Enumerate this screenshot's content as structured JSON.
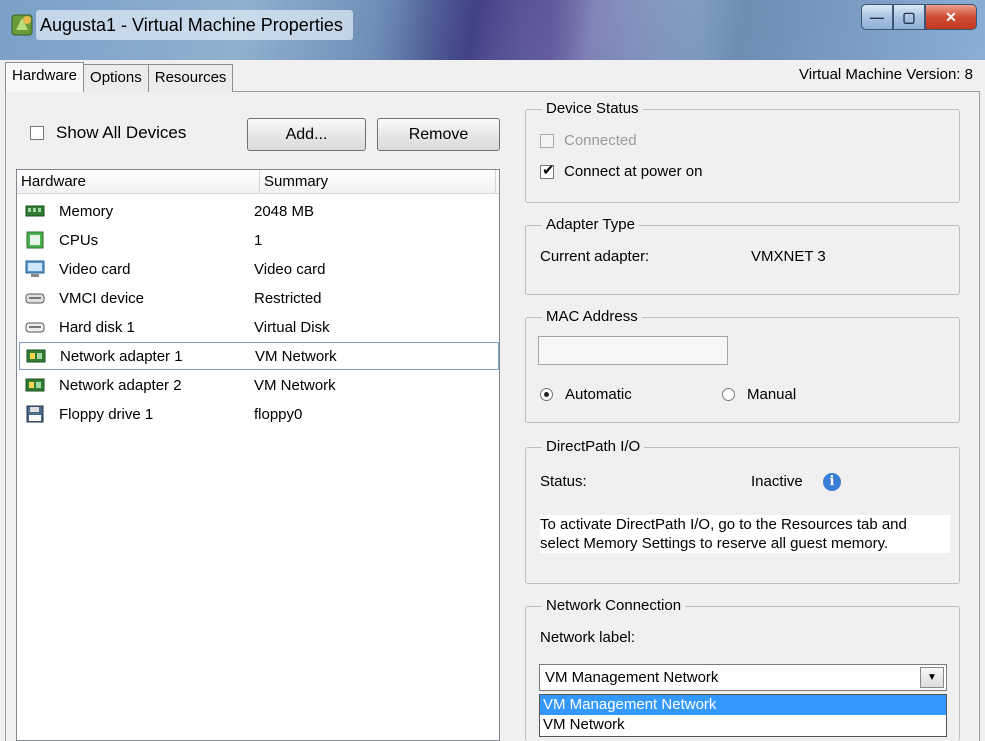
{
  "window": {
    "title": "Augusta1 - Virtual Machine Properties",
    "version_label": "Virtual Machine Version: 8"
  },
  "tabs": [
    {
      "label": "Hardware",
      "active": true
    },
    {
      "label": "Options",
      "active": false
    },
    {
      "label": "Resources",
      "active": false
    }
  ],
  "hardware_panel": {
    "show_all_label": "Show All Devices",
    "show_all_checked": false,
    "add_label": "Add...",
    "remove_label": "Remove",
    "columns": [
      "Hardware",
      "Summary"
    ],
    "rows": [
      {
        "name": "Memory",
        "summary": "2048 MB",
        "icon": "memory-icon"
      },
      {
        "name": "CPUs",
        "summary": "1",
        "icon": "cpu-icon"
      },
      {
        "name": "Video card",
        "summary": "Video card",
        "icon": "monitor-icon"
      },
      {
        "name": "VMCI device",
        "summary": "Restricted",
        "icon": "device-icon"
      },
      {
        "name": "Hard disk 1",
        "summary": "Virtual Disk",
        "icon": "harddisk-icon"
      },
      {
        "name": "Network adapter 1",
        "summary": "VM Network",
        "icon": "network-adapter-icon",
        "selected": true
      },
      {
        "name": "Network adapter 2",
        "summary": "VM Network",
        "icon": "network-adapter-icon"
      },
      {
        "name": "Floppy drive 1",
        "summary": "floppy0",
        "icon": "floppy-icon"
      }
    ]
  },
  "device_status": {
    "title": "Device Status",
    "connected_label": "Connected",
    "connected_checked": false,
    "connect_power_label": "Connect at power on",
    "connect_power_checked": true
  },
  "adapter_type": {
    "title": "Adapter Type",
    "current_label": "Current adapter:",
    "current_value": "VMXNET 3"
  },
  "mac_address": {
    "title": "MAC Address",
    "value": "",
    "automatic_label": "Automatic",
    "manual_label": "Manual",
    "selected": "Automatic"
  },
  "directpath": {
    "title": "DirectPath I/O",
    "status_label": "Status:",
    "status_value": "Inactive",
    "description": "To activate DirectPath I/O, go to the Resources tab and select Memory Settings to reserve all guest memory."
  },
  "network_connection": {
    "title": "Network Connection",
    "label_text": "Network label:",
    "selected": "VM Management Network",
    "options": [
      "VM Management Network",
      "VM Network"
    ],
    "highlighted_option": "VM Management Network"
  },
  "colors": {
    "selection_blue": "#3399ff",
    "info_blue": "#3a7fd5",
    "close_red": "#c13a1f"
  }
}
